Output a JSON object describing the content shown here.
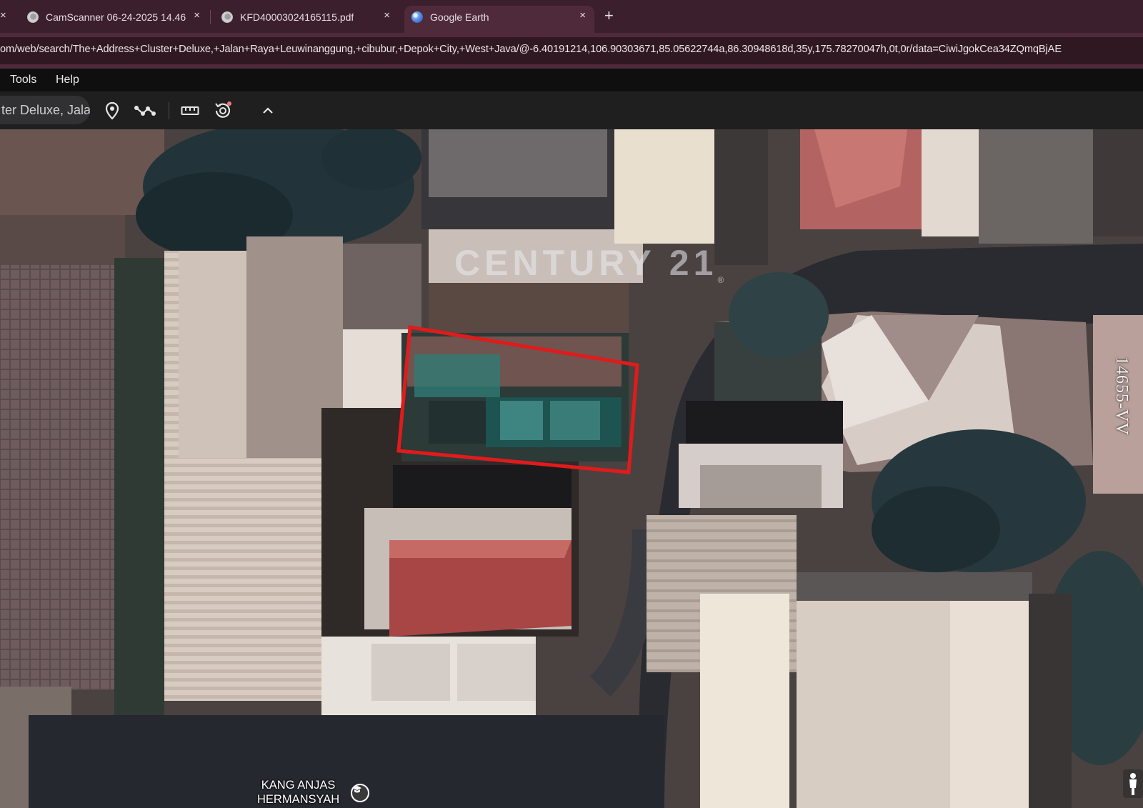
{
  "tabs": [
    {
      "title": "CamScanner 06-24-2025 14.46",
      "icon": "globe-icon",
      "active": false
    },
    {
      "title": "KFD40003024165115.pdf",
      "icon": "globe-icon",
      "active": false
    },
    {
      "title": "Google Earth",
      "icon": "google-earth-icon",
      "active": true
    }
  ],
  "tab_close_glyph": "×",
  "new_tab_glyph": "+",
  "address_bar": {
    "url": "om/web/search/The+Address+Cluster+Deluxe,+Jalan+Raya+Leuwinanggung,+cibubur,+Depok+City,+West+Java/@-6.40191214,106.90303671,85.05622744a,86.30948618d,35y,175.78270047h,0t,0r/data=CiwiJgokCea34ZQmqBjAE"
  },
  "menu": {
    "tools": "Tools",
    "help": "Help"
  },
  "toolbar": {
    "search_value": "ter Deluxe, Jala",
    "icons": [
      "placemark-icon",
      "path-icon",
      "ruler-icon",
      "historical-imagery-icon",
      "collapse-chevron-icon"
    ]
  },
  "map": {
    "watermark": "CENTURY 21",
    "watermark_mark": "®",
    "vertical_label": "14655-VV",
    "place_label_line1": "KANG ANJAS",
    "place_label_line2": "HERMANSYAH",
    "highlight_color": "#e01b1b"
  }
}
